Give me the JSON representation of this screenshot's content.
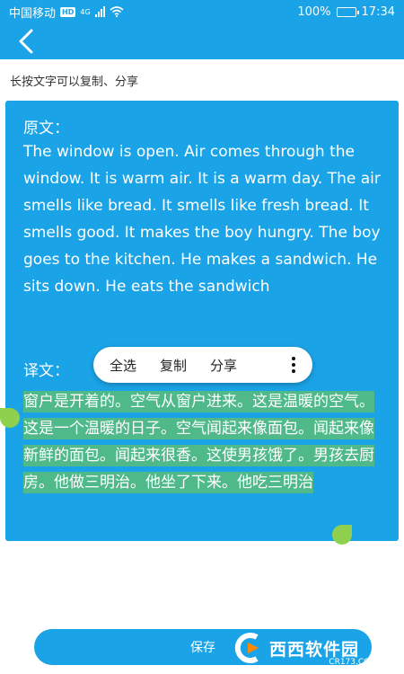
{
  "status_bar": {
    "carrier": "中国移动",
    "hd_badge": "HD",
    "network": "4G",
    "battery": "100%",
    "battery_level": 1.0,
    "time": "17:34"
  },
  "nav": {
    "back_icon": "chevron-left-icon"
  },
  "hint": "长按文字可以复制、分享",
  "original": {
    "label": "原文：",
    "text": "The window is open. Air comes through the window. It is warm air. It is a warm day. The air smells like bread. It smells like fresh bread. It smells good. It makes the boy hungry. The boy goes to the kitchen. He makes a sandwich. He sits down. He eats the sandwich"
  },
  "translation": {
    "label": "译文：",
    "text": "窗户是开着的。空气从窗户进来。这是温暖的空气。这是一个温暖的日子。空气闻起来像面包。闻起来像新鲜的面包。闻起来很香。这使男孩饿了。男孩去厨房。他做三明治。他坐了下来。他吃三明治"
  },
  "popup": {
    "select_all": "全选",
    "copy": "复制",
    "share": "分享",
    "more_icon": "more-vertical-icon"
  },
  "save_button": "保存",
  "watermark": {
    "brand": "西西软件园",
    "site": "CR173.COM"
  },
  "colors": {
    "primary": "#1aa3e6",
    "selection": "#4fb98a",
    "handle": "#8fd14f"
  }
}
